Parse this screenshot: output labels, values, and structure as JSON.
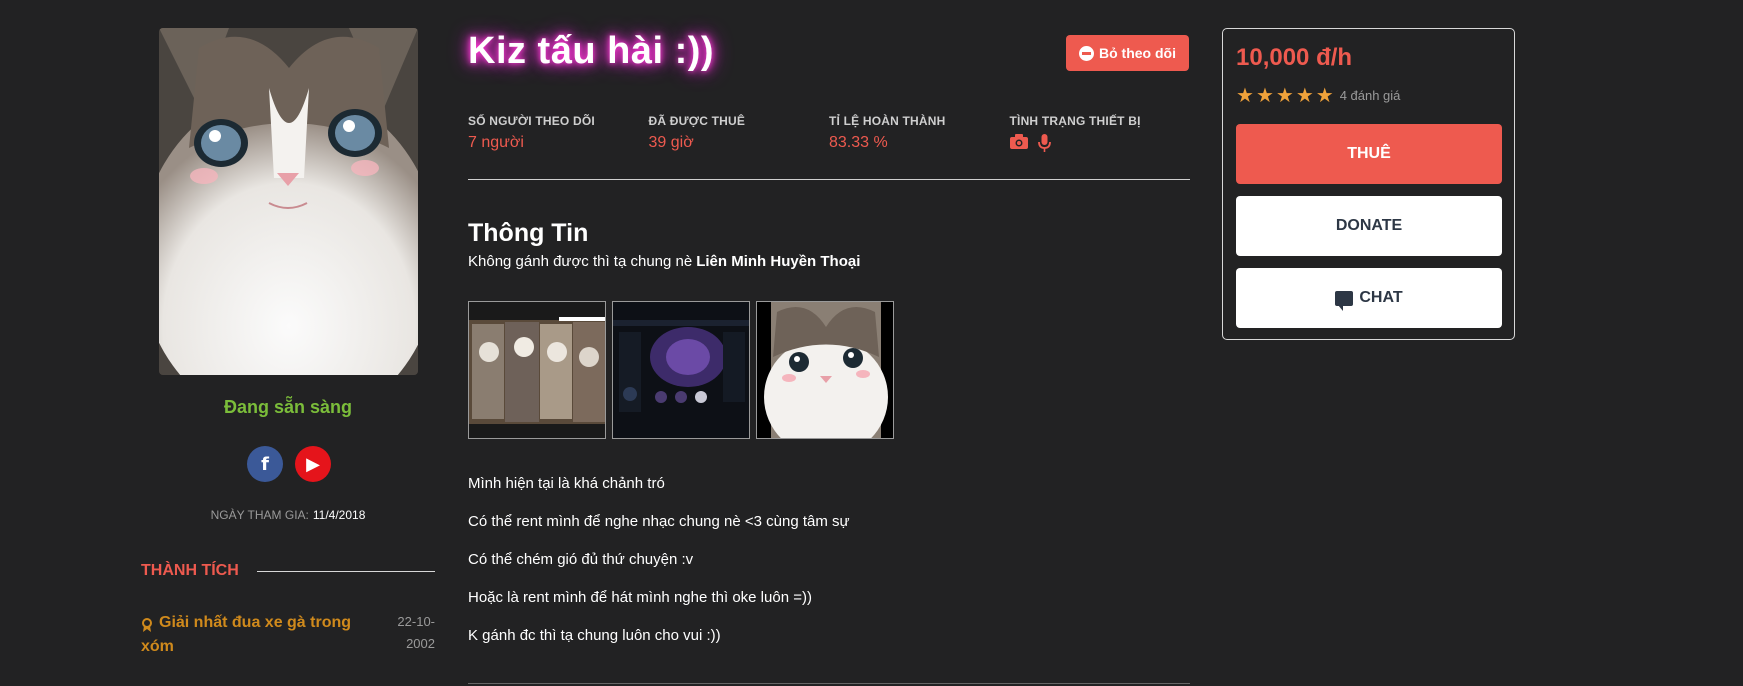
{
  "profile": {
    "status": "Đang sẵn sàng",
    "joined_label": "NGÀY THAM GIA:",
    "joined_date": "11/4/2018"
  },
  "socials": [
    {
      "icon": "facebook-icon",
      "glyph": "f"
    },
    {
      "icon": "youtube-icon",
      "glyph": "▶"
    }
  ],
  "achievements": {
    "title": "THÀNH TÍCH",
    "items": [
      {
        "name": "Giải nhất đua xe gà trong xóm",
        "date": "22-10-2002"
      }
    ]
  },
  "header": {
    "name": "Kiz tấu hài :))",
    "unfollow_label": "Bỏ theo dõi"
  },
  "stats": [
    {
      "label": "SỐ NGƯỜI THEO DÕI",
      "value": "7 người"
    },
    {
      "label": "ĐÃ ĐƯỢC THUÊ",
      "value": "39 giờ"
    },
    {
      "label": "TỈ LỆ HOÀN THÀNH",
      "value": "83.33 %"
    },
    {
      "label": "TÌNH TRẠNG THIẾT BỊ",
      "devices": [
        "camera-icon",
        "microphone-icon"
      ]
    }
  ],
  "info": {
    "title": "Thông Tin",
    "subtitle": "Không gánh được thì tạ chung nè",
    "game": "Liên Minh Huyền Thoại"
  },
  "bio": [
    "Mình hiện tại là khá chảnh tró",
    "Có thể rent mình để nghe nhạc chung nè <3 cùng tâm sự",
    "Có thể chém gió đủ thứ chuyện :v",
    "Hoặc là rent mình để hát mình nghe thì oke luôn =))",
    "K gánh đc thì tạ chung luôn cho vui :))"
  ],
  "card": {
    "price": "10,000 đ/h",
    "stars": 5,
    "rating_count": "4 đánh giá",
    "rent_label": "THUÊ",
    "donate_label": "DONATE",
    "chat_label": "CHAT"
  },
  "colors": {
    "accent": "#ee5a4f",
    "status_green": "#7bbd3a",
    "achievement_gold": "#d08a1c",
    "star": "#f0a23a",
    "neon": "#ff39d5"
  }
}
